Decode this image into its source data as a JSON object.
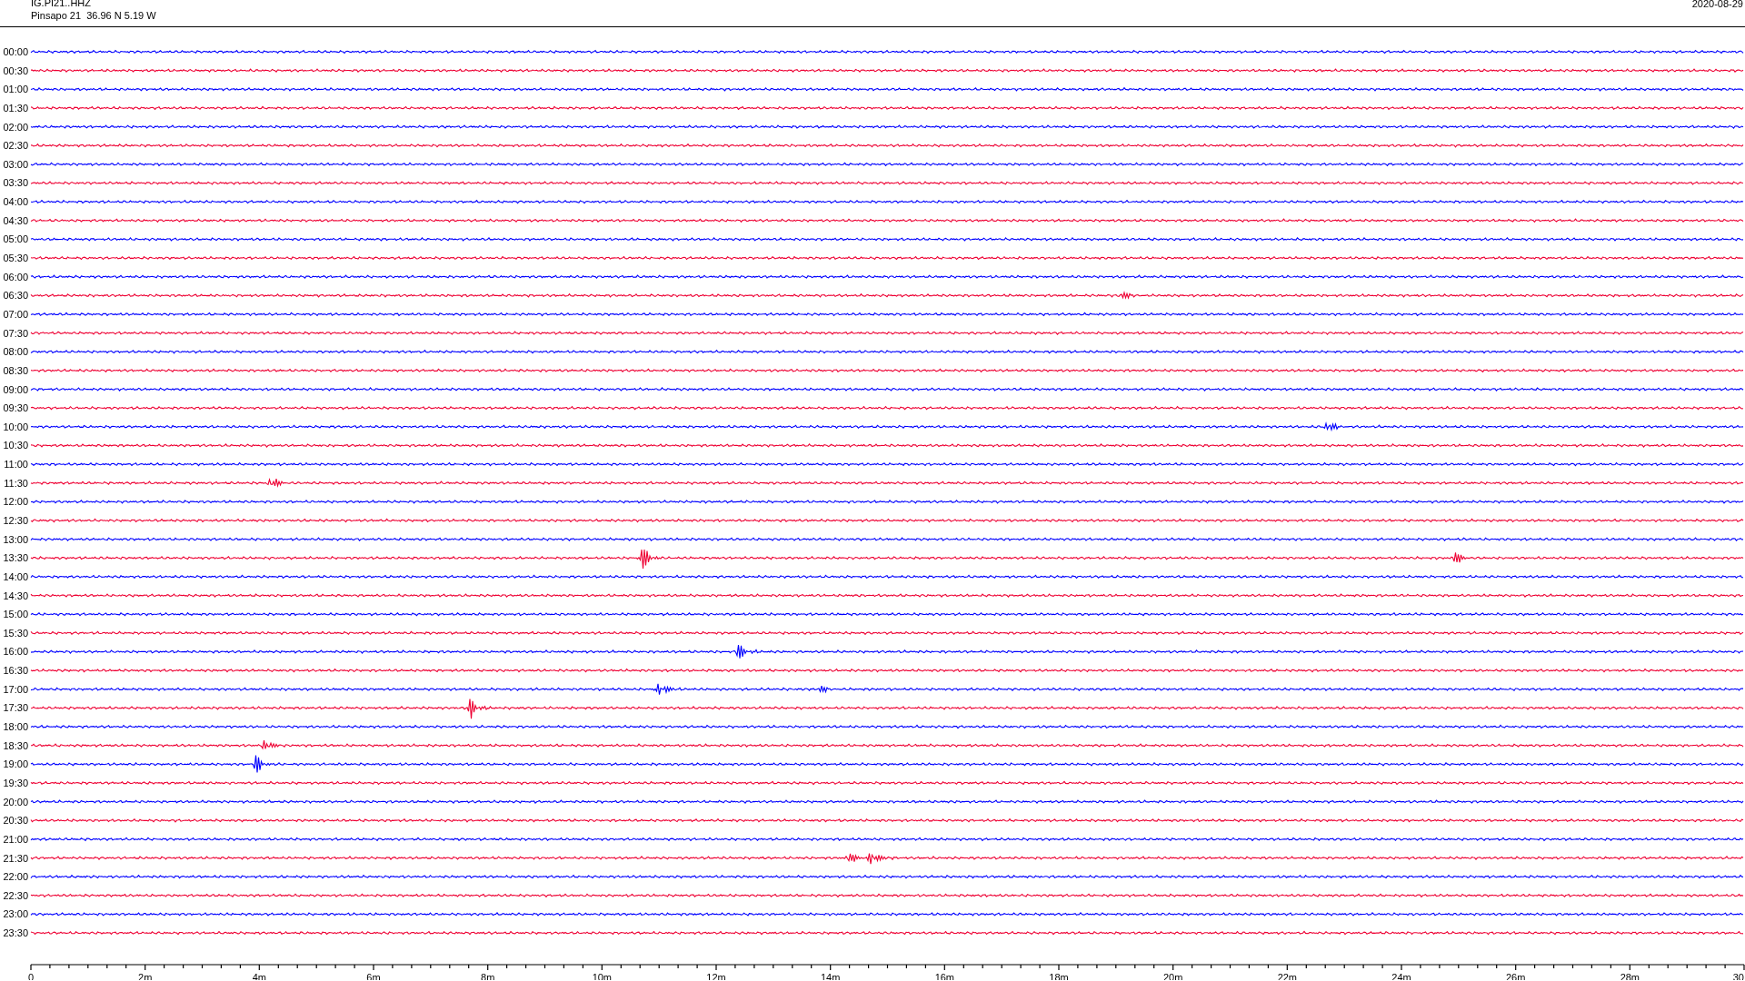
{
  "header": {
    "station": "IG.PI21..HHZ",
    "location": "Pinsapo 21  36.96 N 5.19 W",
    "date": "2020-08-29"
  },
  "traces": [
    {
      "time": "00:00",
      "color": "#0000ff"
    },
    {
      "time": "00:30",
      "color": "#ee0033"
    },
    {
      "time": "01:00",
      "color": "#0000ff"
    },
    {
      "time": "01:30",
      "color": "#ee0033"
    },
    {
      "time": "02:00",
      "color": "#0000ff"
    },
    {
      "time": "02:30",
      "color": "#ee0033"
    },
    {
      "time": "03:00",
      "color": "#0000ff"
    },
    {
      "time": "03:30",
      "color": "#ee0033"
    },
    {
      "time": "04:00",
      "color": "#0000ff"
    },
    {
      "time": "04:30",
      "color": "#ee0033"
    },
    {
      "time": "05:00",
      "color": "#0000ff"
    },
    {
      "time": "05:30",
      "color": "#ee0033"
    },
    {
      "time": "06:00",
      "color": "#0000ff"
    },
    {
      "time": "06:30",
      "color": "#ee0033"
    },
    {
      "time": "07:00",
      "color": "#0000ff"
    },
    {
      "time": "07:30",
      "color": "#ee0033"
    },
    {
      "time": "08:00",
      "color": "#0000ff"
    },
    {
      "time": "08:30",
      "color": "#ee0033"
    },
    {
      "time": "09:00",
      "color": "#0000ff"
    },
    {
      "time": "09:30",
      "color": "#ee0033"
    },
    {
      "time": "10:00",
      "color": "#0000ff"
    },
    {
      "time": "10:30",
      "color": "#ee0033"
    },
    {
      "time": "11:00",
      "color": "#0000ff"
    },
    {
      "time": "11:30",
      "color": "#ee0033"
    },
    {
      "time": "12:00",
      "color": "#0000ff"
    },
    {
      "time": "12:30",
      "color": "#ee0033"
    },
    {
      "time": "13:00",
      "color": "#0000ff"
    },
    {
      "time": "13:30",
      "color": "#ee0033"
    },
    {
      "time": "14:00",
      "color": "#0000ff"
    },
    {
      "time": "14:30",
      "color": "#ee0033"
    },
    {
      "time": "15:00",
      "color": "#0000ff"
    },
    {
      "time": "15:30",
      "color": "#ee0033"
    },
    {
      "time": "16:00",
      "color": "#0000ff"
    },
    {
      "time": "16:30",
      "color": "#ee0033"
    },
    {
      "time": "17:00",
      "color": "#0000ff"
    },
    {
      "time": "17:30",
      "color": "#ee0033"
    },
    {
      "time": "18:00",
      "color": "#0000ff"
    },
    {
      "time": "18:30",
      "color": "#ee0033"
    },
    {
      "time": "19:00",
      "color": "#0000ff"
    },
    {
      "time": "19:30",
      "color": "#ee0033"
    },
    {
      "time": "20:00",
      "color": "#0000ff"
    },
    {
      "time": "20:30",
      "color": "#ee0033"
    },
    {
      "time": "21:00",
      "color": "#0000ff"
    },
    {
      "time": "21:30",
      "color": "#ee0033"
    },
    {
      "time": "22:00",
      "color": "#0000ff"
    },
    {
      "time": "22:30",
      "color": "#ee0033"
    },
    {
      "time": "23:00",
      "color": "#0000ff"
    },
    {
      "time": "23:30",
      "color": "#ee0033"
    }
  ],
  "x_axis": {
    "tick_labels": [
      "0",
      "2m",
      "4m",
      "6m",
      "8m",
      "10m",
      "12m",
      "14m",
      "16m",
      "18m",
      "20m",
      "22m",
      "24m",
      "26m",
      "28m",
      "30"
    ]
  }
}
